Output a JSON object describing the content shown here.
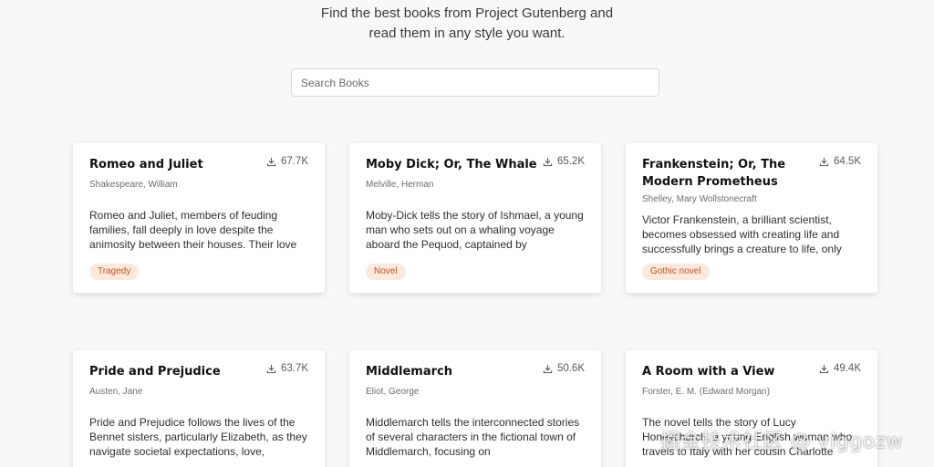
{
  "header": {
    "tagline_line1": "Find the best books from Project Gutenberg and",
    "tagline_line2": "read them in any style you want."
  },
  "search": {
    "placeholder": "Search Books",
    "value": ""
  },
  "books": [
    {
      "title": "Romeo and Juliet",
      "author": "Shakespeare, William",
      "downloads": "67.7K",
      "description": "Romeo and Juliet, members of feuding families, fall deeply in love despite the animosity between their houses. Their love",
      "genre": "Tragedy"
    },
    {
      "title": "Moby Dick; Or, The Whale",
      "author": "Melville, Herman",
      "downloads": "65.2K",
      "description": "Moby-Dick tells the story of Ishmael, a young man who sets out on a whaling voyage aboard the Pequod, captained by",
      "genre": "Novel"
    },
    {
      "title": "Frankenstein; Or, The Modern Prometheus",
      "author": "Shelley, Mary Wollstonecraft",
      "downloads": "64.5K",
      "description": "Victor Frankenstein, a brilliant scientist, becomes obsessed with creating life and successfully brings a creature to life, only",
      "genre": "Gothic novel"
    },
    {
      "title": "Pride and Prejudice",
      "author": "Austen, Jane",
      "downloads": "63.7K",
      "description": "Pride and Prejudice follows the lives of the Bennet sisters, particularly Elizabeth, as they navigate societal expectations, love,",
      "genre": ""
    },
    {
      "title": "Middlemarch",
      "author": "Eliot, George",
      "downloads": "50.6K",
      "description": "Middlemarch tells the interconnected stories of several characters in the fictional town of Middlemarch, focusing on",
      "genre": ""
    },
    {
      "title": "A Room with a View",
      "author": "Forster, E. M. (Edward Morgan)",
      "downloads": "49.4K",
      "description": "The novel tells the story of Lucy Honeychurch, a young English woman who travels to Italy with her cousin Charlotte",
      "genre": ""
    }
  ],
  "watermark": "掘金技术社区 @ viggozw",
  "colors": {
    "background": "#f8f8f8",
    "card": "#ffffff",
    "badge_bg": "#fde9db",
    "badge_text": "#c2502a"
  },
  "icons": {
    "download": "download-icon"
  }
}
